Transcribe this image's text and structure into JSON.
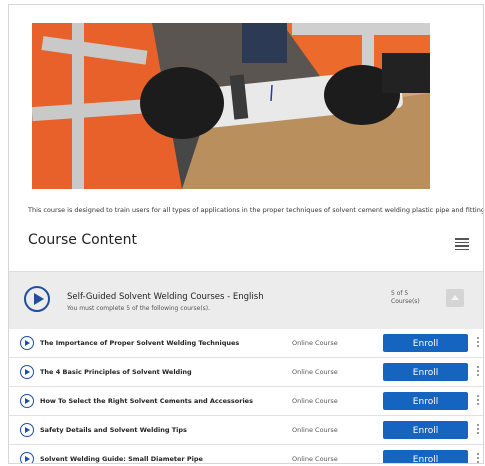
{
  "course": {
    "description": "This course is designed to train users for all types of applications in the proper techniques of solvent cement welding plastic pipe and fittings."
  },
  "content": {
    "title": "Course Content",
    "menu_icon": "list-menu-icon"
  },
  "group": {
    "title": "Self-Guided Solvent Welding Courses - English",
    "subtitle": "You must complete 5 of the following course(s).",
    "count_line1": "5 of 5",
    "count_line2": "Course(s)",
    "play_icon": "play-circle-icon",
    "collapse_icon": "chevron-up-icon"
  },
  "rows": [
    {
      "title": "The Importance of Proper Solvent Welding Techniques",
      "type": "Online Course",
      "action": "Enroll"
    },
    {
      "title": "The 4 Basic Principles of Solvent Welding",
      "type": "Online Course",
      "action": "Enroll"
    },
    {
      "title": "How To Select the Right Solvent Cements and Accessories",
      "type": "Online Course",
      "action": "Enroll"
    },
    {
      "title": "Safety Details and Solvent Welding Tips",
      "type": "Online Course",
      "action": "Enroll"
    },
    {
      "title": "Solvent Welding Guide: Small Diameter Pipe",
      "type": "Online Course",
      "action": "Enroll"
    }
  ],
  "colors": {
    "accent": "#1565c0",
    "play_icon": "#1f4f9e",
    "group_bg": "#ececec"
  }
}
